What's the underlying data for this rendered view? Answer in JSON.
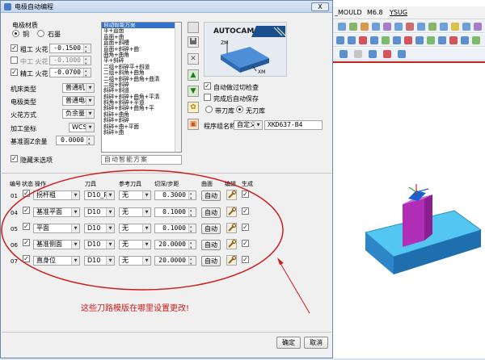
{
  "dialog": {
    "title": "电极自动编程",
    "close_label": "X"
  },
  "material": {
    "label": "电极材质",
    "options": [
      "铜",
      "石墨"
    ],
    "selected": "铜"
  },
  "sparks": {
    "rough": {
      "label": "粗工 火花",
      "value": "-0.1500",
      "checked": true
    },
    "medium": {
      "label": "中工 火花",
      "value": "-0.1000",
      "checked": false
    },
    "fine": {
      "label": "精工 火花",
      "value": "-0.0700",
      "checked": true
    }
  },
  "settings": {
    "machine_type": {
      "label": "机床类型",
      "value": "普通机"
    },
    "electrode_type": {
      "label": "电极类型",
      "value": "普通电极"
    },
    "spark_mode": {
      "label": "火花方式",
      "value": "负余量"
    },
    "coord": {
      "label": "加工坐标",
      "value": "WCS"
    },
    "base_z": {
      "label": "基准面Z余量",
      "value": "0.0000"
    },
    "hide_unselected": {
      "label": "隐藏未选项",
      "checked": true
    }
  },
  "plan_list": {
    "items": [
      "自动智能方案",
      "平+直面",
      "直面+曲",
      "直面+斜槽",
      "直面+斜碎+曲",
      "曲角+曲角",
      "平+斜碎",
      "二组+斜碎平+斜道",
      "二组+斜角+曲角",
      "二组+斜碎+曲角+曲清",
      "二组+斜碎",
      "斜碎+斜道",
      "斜碎+斜碎+曲角+平清",
      "斜角+斜碎+平道",
      "斜碎+斜碎+曲角+平",
      "斜碎+曲角",
      "斜碎+斜碎",
      "斜碎+曲+平面",
      "斜碎+曲"
    ],
    "selected_index": 0,
    "current": "自动智能方案"
  },
  "preview": {
    "logo": "AUTOCAM",
    "axis_zm": "ZM",
    "axis_xm": "XM"
  },
  "options": {
    "auto_check": {
      "label": "自动做过切检查",
      "checked": true
    },
    "auto_save": {
      "label": "完成后自动保存",
      "checked": false
    },
    "lib_with": "带刀库",
    "lib_without": "无刀库",
    "lib_selected": "无刀库"
  },
  "program": {
    "label": "程序组名称",
    "mode": "自定义",
    "name": "XKD637-B4"
  },
  "table": {
    "headers": [
      "编号",
      "状态",
      "操作",
      "刀具",
      "参考刀具",
      "切深/步距",
      "曲面",
      "编辑",
      "生成"
    ],
    "rows": [
      {
        "no": "01",
        "state": true,
        "operation": "拐杆粗",
        "tool": "D10_R",
        "ref_tool": "无",
        "step": "0.3000",
        "surface": "自动",
        "gen": true
      },
      {
        "no": "04",
        "state": true,
        "operation": "基准平面",
        "tool": "D10",
        "ref_tool": "无",
        "step": "0.1000",
        "surface": "自动",
        "gen": true
      },
      {
        "no": "05",
        "state": true,
        "operation": "平面",
        "tool": "D10",
        "ref_tool": "无",
        "step": "0.1000",
        "surface": "自动",
        "gen": true
      },
      {
        "no": "06",
        "state": true,
        "operation": "基准侧面",
        "tool": "D10",
        "ref_tool": "无",
        "step": "20.0000",
        "surface": "自动",
        "gen": true
      },
      {
        "no": "07",
        "state": true,
        "operation": "直身位",
        "tool": "D10",
        "ref_tool": "无",
        "step": "20.0000",
        "surface": "自动",
        "gen": true
      }
    ]
  },
  "annotation": "这些刀路模版在哪里设置更改!",
  "buttons": {
    "ok": "确定",
    "cancel": "取消"
  },
  "cad": {
    "menu": [
      "_MOULD",
      "M6.8",
      "YSUG"
    ]
  },
  "colors": {
    "annotation": "#d11a1a",
    "selection": "#3373cf",
    "block_top": "#53c7f1",
    "electrode": "#b12fb6"
  }
}
